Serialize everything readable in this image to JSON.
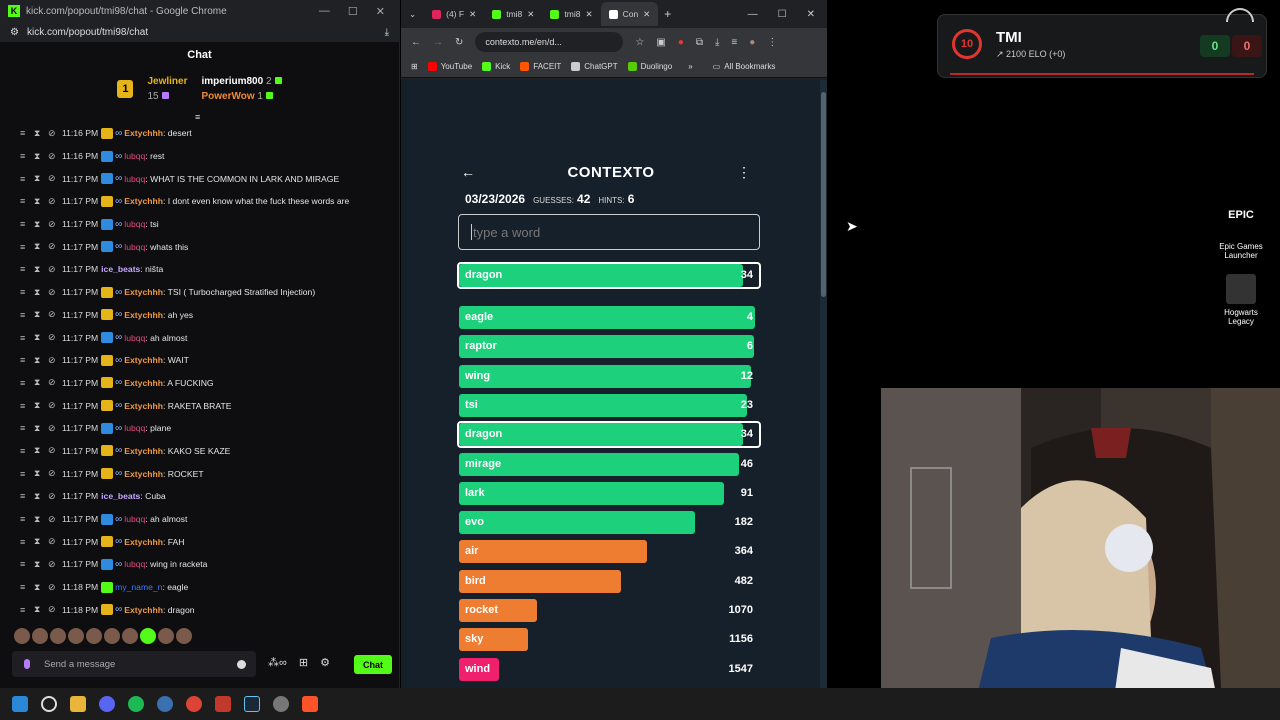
{
  "chat_window": {
    "title": "kick.com/popout/tmi98/chat - Google Chrome",
    "url": "kick.com/popout/tmi98/chat",
    "header": "Chat",
    "leaders": {
      "first_name": "Jewliner",
      "first_count": "15",
      "second_name": "imperium800",
      "second_count": "2",
      "third_name": "PowerWow",
      "third_count": "1",
      "rank": "1"
    },
    "messages": [
      {
        "time": "11:16 PM",
        "user": "Extychhh",
        "text": ": desert",
        "color": "ext"
      },
      {
        "time": "11:16 PM",
        "user": "lubqq",
        "text": ": rest",
        "color": "lub"
      },
      {
        "time": "11:17 PM",
        "user": "lubqq",
        "text": ": WHAT IS THE COMMON IN LARK AND MIRAGE",
        "color": "lub"
      },
      {
        "time": "11:17 PM",
        "user": "Extychhh",
        "text": ": I dont even know what the fuck these words are",
        "color": "ext"
      },
      {
        "time": "11:17 PM",
        "user": "lubqq",
        "text": ": tsi",
        "color": "lub"
      },
      {
        "time": "11:17 PM",
        "user": "lubqq",
        "text": ": whats this",
        "color": "lub"
      },
      {
        "time": "11:17 PM",
        "user": "ice_beats",
        "text": ": ništa",
        "color": "ice"
      },
      {
        "time": "11:17 PM",
        "user": "Extychhh",
        "text": ": TSI ( Turbocharged Stratified Injection)",
        "color": "ext"
      },
      {
        "time": "11:17 PM",
        "user": "Extychhh",
        "text": ": ah yes",
        "color": "ext"
      },
      {
        "time": "11:17 PM",
        "user": "lubqq",
        "text": ": ah almost",
        "color": "lub"
      },
      {
        "time": "11:17 PM",
        "user": "Extychhh",
        "text": ": WAIT",
        "color": "ext"
      },
      {
        "time": "11:17 PM",
        "user": "Extychhh",
        "text": ": A FUCKING",
        "color": "ext"
      },
      {
        "time": "11:17 PM",
        "user": "Extychhh",
        "text": ": RAKETA BRATE",
        "color": "ext"
      },
      {
        "time": "11:17 PM",
        "user": "lubqq",
        "text": ": plane",
        "color": "lub"
      },
      {
        "time": "11:17 PM",
        "user": "Extychhh",
        "text": ": KAKO SE KAZE",
        "color": "ext"
      },
      {
        "time": "11:17 PM",
        "user": "Extychhh",
        "text": ": ROCKET",
        "color": "ext"
      },
      {
        "time": "11:17 PM",
        "user": "ice_beats",
        "text": ": Cuba",
        "color": "ice"
      },
      {
        "time": "11:17 PM",
        "user": "lubqq",
        "text": ": ah almost",
        "color": "lub"
      },
      {
        "time": "11:17 PM",
        "user": "Extychhh",
        "text": ": FAH",
        "color": "ext"
      },
      {
        "time": "11:17 PM",
        "user": "lubqq",
        "text": ": wing in racketa",
        "color": "lub"
      },
      {
        "time": "11:18 PM",
        "user": "my_name_n",
        "text": ": eagle",
        "color": "my"
      },
      {
        "time": "11:18 PM",
        "user": "Extychhh",
        "text": ": dragon",
        "color": "ext"
      }
    ],
    "send_placeholder": "Send a message",
    "chat_button": "Chat"
  },
  "browser": {
    "tabs": [
      {
        "label": "(4) F",
        "color": "#e0245e"
      },
      {
        "label": "tmi8",
        "color": "#53fc18"
      },
      {
        "label": "tmi8",
        "color": "#53fc18"
      },
      {
        "label": "Con",
        "color": "#ffffff",
        "active": true
      }
    ],
    "url": "contexto.me/en/d...",
    "bookmarks": [
      {
        "label": "YouTube",
        "color": "#ff0000"
      },
      {
        "label": "Kick",
        "color": "#53fc18"
      },
      {
        "label": "FACEIT",
        "color": "#ff5500"
      },
      {
        "label": "ChatGPT",
        "color": "#cccccc"
      },
      {
        "label": "Duolingo",
        "color": "#58cc02"
      }
    ],
    "all_bookmarks": "All Bookmarks",
    "more": "»"
  },
  "contexto": {
    "title": "CONTEXTO",
    "date": "03/23/2026",
    "guesses_label": "GUESSES:",
    "guesses": "42",
    "hints_label": "HINTS:",
    "hints": "6",
    "input_placeholder": "type a word",
    "last_guess": {
      "word": "dragon",
      "distance": 34,
      "fill": 0.953,
      "color": "#1cd07c"
    },
    "guesses_list": [
      {
        "word": "eagle",
        "distance": 4,
        "fill": 0.993,
        "color": "#1cd07c"
      },
      {
        "word": "raptor",
        "distance": 6,
        "fill": 0.99,
        "color": "#1cd07c"
      },
      {
        "word": "wing",
        "distance": 12,
        "fill": 0.98,
        "color": "#1cd07c"
      },
      {
        "word": "tsi",
        "distance": 23,
        "fill": 0.967,
        "color": "#1cd07c"
      },
      {
        "word": "dragon",
        "distance": 34,
        "fill": 0.953,
        "color": "#1cd07c",
        "highlight": true
      },
      {
        "word": "mirage",
        "distance": 46,
        "fill": 0.94,
        "color": "#1cd07c"
      },
      {
        "word": "lark",
        "distance": 91,
        "fill": 0.89,
        "color": "#1cd07c"
      },
      {
        "word": "evo",
        "distance": 182,
        "fill": 0.793,
        "color": "#1cd07c"
      },
      {
        "word": "air",
        "distance": 364,
        "fill": 0.63,
        "color": "#ef7d31"
      },
      {
        "word": "bird",
        "distance": 482,
        "fill": 0.543,
        "color": "#ef7d31"
      },
      {
        "word": "rocket",
        "distance": 1070,
        "fill": 0.263,
        "color": "#ef7d31"
      },
      {
        "word": "sky",
        "distance": 1156,
        "fill": 0.233,
        "color": "#ef7d31"
      },
      {
        "word": "wind",
        "distance": 1547,
        "fill": 0.133,
        "color": "#f0216c"
      }
    ]
  },
  "elo_widget": {
    "level": "10",
    "name": "TMI",
    "elo": "2100 ELO (+0)",
    "wins": "0",
    "losses": "0"
  },
  "desktop": {
    "epic_label": "Epic Games Launcher",
    "epic_logo": "EPIC",
    "hogwarts_label": "Hogwarts Legacy"
  }
}
